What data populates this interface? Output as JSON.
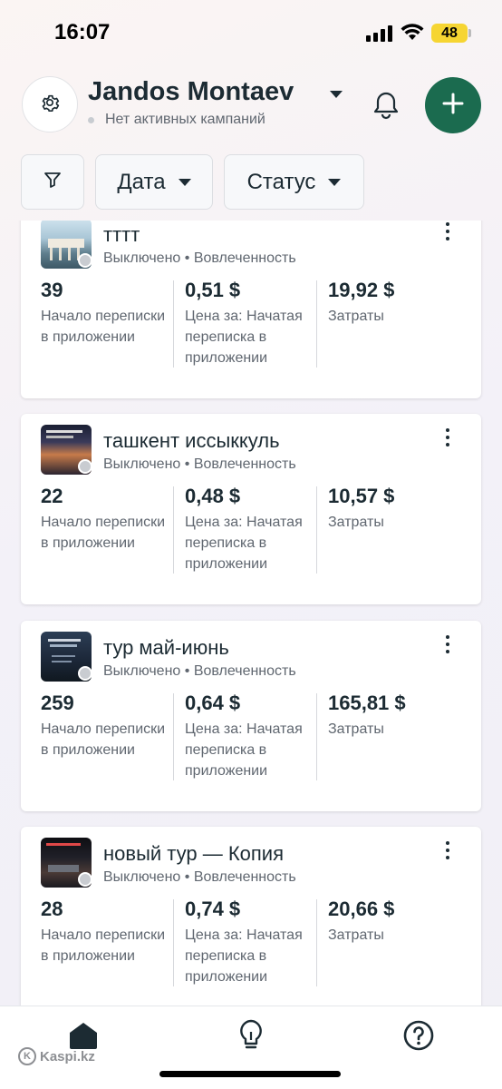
{
  "status_bar": {
    "time": "16:07",
    "battery": "48"
  },
  "header": {
    "account_name": "Jandos Montaev",
    "account_status": "Нет активных кампаний"
  },
  "filters": {
    "date_label": "Дата",
    "status_label": "Статус"
  },
  "campaigns": [
    {
      "name": "тттт",
      "state": "Выключено",
      "objective": "Вовлеченность",
      "results_value": "39",
      "results_label": "Начало переписки в приложении",
      "cost_value": "0,51 $",
      "cost_label": "Цена за: Начатая переписка в приложении",
      "spend_value": "19,92 $",
      "spend_label": "Затраты"
    },
    {
      "name": "ташкент иссыккуль",
      "state": "Выключено",
      "objective": "Вовлеченность",
      "results_value": "22",
      "results_label": "Начало переписки в приложении",
      "cost_value": "0,48 $",
      "cost_label": "Цена за: Начатая переписка в приложении",
      "spend_value": "10,57 $",
      "spend_label": "Затраты"
    },
    {
      "name": "тур май-июнь",
      "state": "Выключено",
      "objective": "Вовлеченность",
      "results_value": "259",
      "results_label": "Начало переписки в приложении",
      "cost_value": "0,64 $",
      "cost_label": "Цена за: Начатая переписка в приложении",
      "spend_value": "165,81 $",
      "spend_label": "Затраты"
    },
    {
      "name": "новый тур — Копия",
      "state": "Выключено",
      "objective": "Вовлеченность",
      "results_value": "28",
      "results_label": "Начало переписки в приложении",
      "cost_value": "0,74 $",
      "cost_label": "Цена за: Начатая переписка в приложении",
      "spend_value": "20,66 $",
      "spend_label": "Затраты"
    }
  ],
  "meta_separator": "•",
  "nav": {
    "items": [
      "home-icon",
      "lightbulb-icon",
      "help-icon"
    ]
  },
  "watermark": "Kaspi.kz",
  "colors": {
    "accent": "#1b6b4f",
    "text": "#1c2b33",
    "muted": "#606770"
  }
}
